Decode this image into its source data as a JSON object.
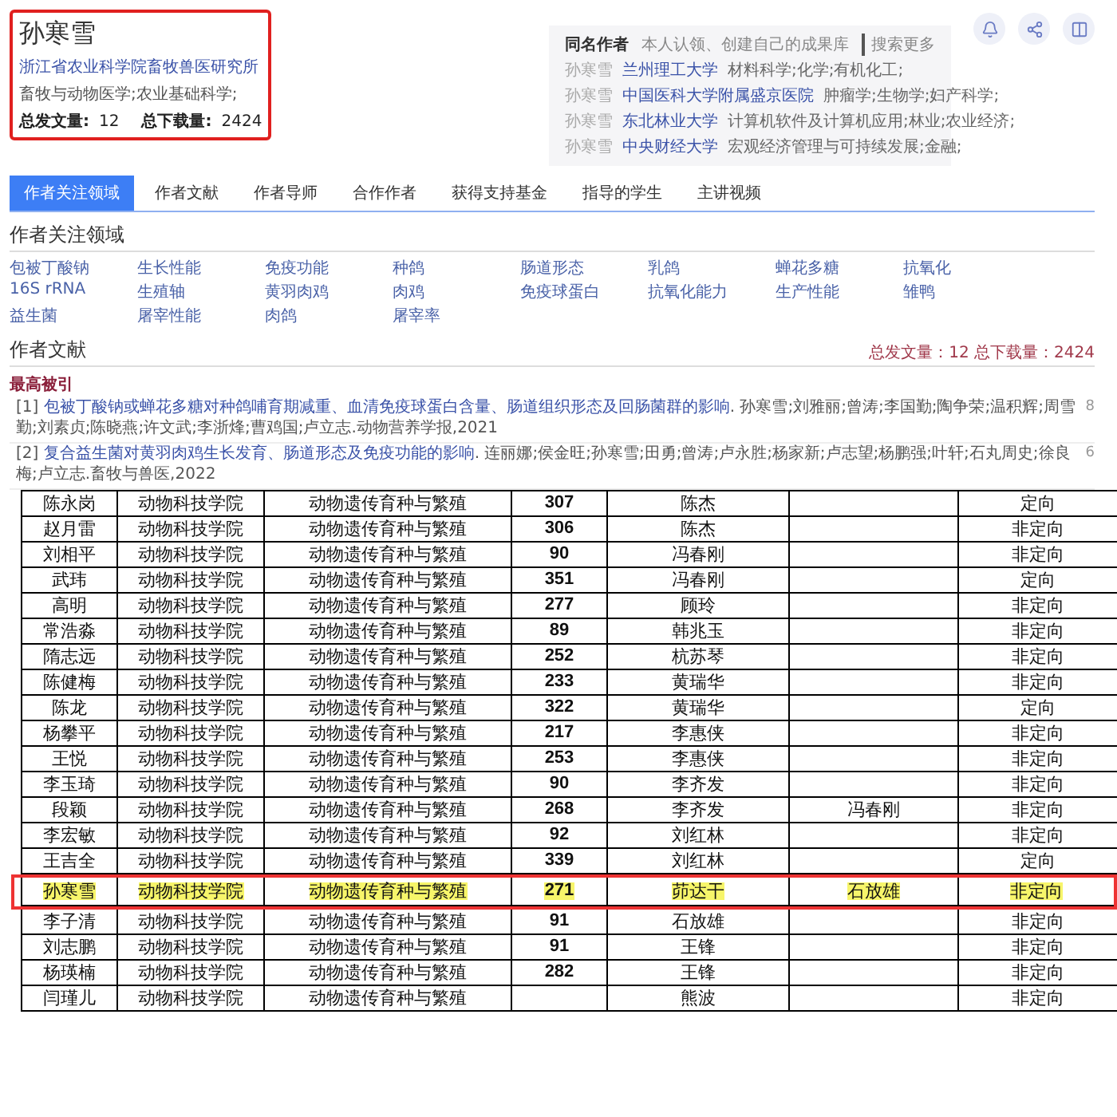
{
  "author": {
    "name": "孙寒雪",
    "affiliation": "浙江省农业科学院畜牧兽医研究所",
    "subjects": "畜牧与动物医学;农业基础科学;",
    "stats": [
      {
        "label": "总发文量:",
        "value": "12"
      },
      {
        "label": "总下载量:",
        "value": "2424"
      }
    ],
    "annotated": true
  },
  "same_name": {
    "title": "同名作者",
    "note": "本人认领、创建自己的成果库",
    "link": "搜索更多",
    "entries": [
      {
        "name": "孙寒雪",
        "org": "兰州理工大学",
        "fields": "材料科学;化学;有机化工;"
      },
      {
        "name": "孙寒雪",
        "org": "中国医科大学附属盛京医院",
        "fields": "肿瘤学;生物学;妇产科学;"
      },
      {
        "name": "孙寒雪",
        "org": "东北林业大学",
        "fields": "计算机软件及计算机应用;林业;农业经济;"
      },
      {
        "name": "孙寒雪",
        "org": "中央财经大学",
        "fields": "宏观经济管理与可持续发展;金融;"
      }
    ]
  },
  "tabs": [
    {
      "label": "作者关注领域",
      "selected": true
    },
    {
      "label": "作者文献",
      "selected": false
    },
    {
      "label": "作者导师",
      "selected": false
    },
    {
      "label": "合作作者",
      "selected": false
    },
    {
      "label": "获得支持基金",
      "selected": false
    },
    {
      "label": "指导的学生",
      "selected": false
    },
    {
      "label": "主讲视频",
      "selected": false
    }
  ],
  "focus": {
    "title": "作者关注领域",
    "keywords": [
      "包被丁酸钠",
      "生长性能",
      "免疫功能",
      "种鸽",
      "肠道形态",
      "乳鸽",
      "蝉花多糖",
      "抗氧化",
      "16S rRNA",
      "生殖轴",
      "黄羽肉鸡",
      "肉鸡",
      "免疫球蛋白",
      "抗氧化能力",
      "生产性能",
      "雏鸭",
      "益生菌",
      "屠宰性能",
      "肉鸽",
      "屠宰率"
    ]
  },
  "literature": {
    "title": "作者文献",
    "summary": "总发文量：12 总下载量：2424",
    "subheading": "最高被引",
    "items": [
      {
        "index": "[1]",
        "title": "包被丁酸钠或蝉花多糖对种鸽哺育期减重、血清免疫球蛋白含量、肠道组织形态及回肠菌群的影响",
        "rest": ". 孙寒雪;刘雅丽;曾涛;李国勤;陶争荣;温积辉;周雪勤;刘素贞;陈晓燕;许文武;李浙烽;曹鸡国;卢立志.动物营养学报,2021",
        "count": "8"
      },
      {
        "index": "[2]",
        "title": "复合益生菌对黄羽肉鸡生长发育、肠道形态及免疫功能的影响",
        "rest": ". 连丽娜;侯金旺;孙寒雪;田勇;曾涛;卢永胜;杨家新;卢志望;杨鹏强;叶轩;石丸周史;徐良梅;卢立志.畜牧与兽医,2022",
        "count": "6"
      }
    ]
  },
  "table": {
    "rows": [
      {
        "cells": [
          "陈永岗",
          "动物科技学院",
          "动物遗传育种与繁殖",
          "307",
          "陈杰",
          "",
          "定向"
        ],
        "highlighted": false
      },
      {
        "cells": [
          "赵月雷",
          "动物科技学院",
          "动物遗传育种与繁殖",
          "306",
          "陈杰",
          "",
          "非定向"
        ],
        "highlighted": false
      },
      {
        "cells": [
          "刘相平",
          "动物科技学院",
          "动物遗传育种与繁殖",
          "90",
          "冯春刚",
          "",
          "非定向"
        ],
        "highlighted": false
      },
      {
        "cells": [
          "武玮",
          "动物科技学院",
          "动物遗传育种与繁殖",
          "351",
          "冯春刚",
          "",
          "定向"
        ],
        "highlighted": false
      },
      {
        "cells": [
          "高明",
          "动物科技学院",
          "动物遗传育种与繁殖",
          "277",
          "顾玲",
          "",
          "非定向"
        ],
        "highlighted": false
      },
      {
        "cells": [
          "常浩淼",
          "动物科技学院",
          "动物遗传育种与繁殖",
          "89",
          "韩兆玉",
          "",
          "非定向"
        ],
        "highlighted": false
      },
      {
        "cells": [
          "隋志远",
          "动物科技学院",
          "动物遗传育种与繁殖",
          "252",
          "杭苏琴",
          "",
          "非定向"
        ],
        "highlighted": false
      },
      {
        "cells": [
          "陈健梅",
          "动物科技学院",
          "动物遗传育种与繁殖",
          "233",
          "黄瑞华",
          "",
          "非定向"
        ],
        "highlighted": false
      },
      {
        "cells": [
          "陈龙",
          "动物科技学院",
          "动物遗传育种与繁殖",
          "322",
          "黄瑞华",
          "",
          "定向"
        ],
        "highlighted": false
      },
      {
        "cells": [
          "杨攀平",
          "动物科技学院",
          "动物遗传育种与繁殖",
          "217",
          "李惠侠",
          "",
          "非定向"
        ],
        "highlighted": false
      },
      {
        "cells": [
          "王悦",
          "动物科技学院",
          "动物遗传育种与繁殖",
          "253",
          "李惠侠",
          "",
          "非定向"
        ],
        "highlighted": false
      },
      {
        "cells": [
          "李玉琦",
          "动物科技学院",
          "动物遗传育种与繁殖",
          "90",
          "李齐发",
          "",
          "非定向"
        ],
        "highlighted": false
      },
      {
        "cells": [
          "段颖",
          "动物科技学院",
          "动物遗传育种与繁殖",
          "268",
          "李齐发",
          "冯春刚",
          "非定向"
        ],
        "highlighted": false
      },
      {
        "cells": [
          "李宏敏",
          "动物科技学院",
          "动物遗传育种与繁殖",
          "92",
          "刘红林",
          "",
          "非定向"
        ],
        "highlighted": false
      },
      {
        "cells": [
          "王吉全",
          "动物科技学院",
          "动物遗传育种与繁殖",
          "339",
          "刘红林",
          "",
          "定向"
        ],
        "highlighted": false
      },
      {
        "cells": [
          "孙寒雪",
          "动物科技学院",
          "动物遗传育种与繁殖",
          "271",
          "茆达干",
          "石放雄",
          "非定向"
        ],
        "highlighted": true
      },
      {
        "cells": [
          "李子清",
          "动物科技学院",
          "动物遗传育种与繁殖",
          "91",
          "石放雄",
          "",
          "非定向"
        ],
        "highlighted": false
      },
      {
        "cells": [
          "刘志鹏",
          "动物科技学院",
          "动物遗传育种与繁殖",
          "91",
          "王锋",
          "",
          "非定向"
        ],
        "highlighted": false
      },
      {
        "cells": [
          "杨瑛楠",
          "动物科技学院",
          "动物遗传育种与繁殖",
          "282",
          "王锋",
          "",
          "非定向"
        ],
        "highlighted": false
      },
      {
        "cells": [
          "闫瑾儿",
          "动物科技学院",
          "动物遗传育种与繁殖",
          "",
          "熊波",
          "",
          "非定向"
        ],
        "highlighted": false
      }
    ]
  }
}
